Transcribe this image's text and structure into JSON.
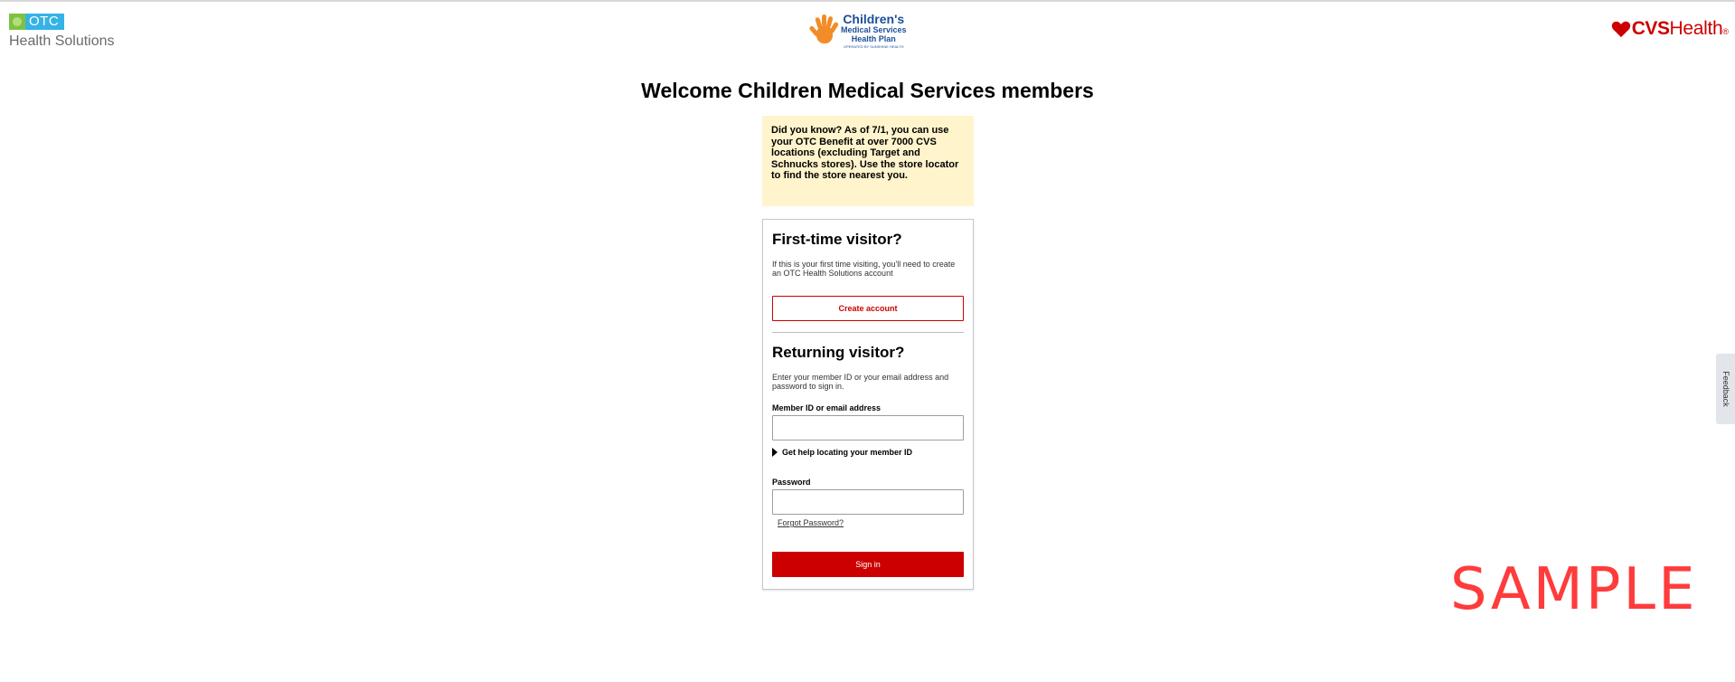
{
  "header": {
    "otc_logo": {
      "box_text": "OTC",
      "subtitle": "Health Solutions",
      "leaf_color": "#7fc241",
      "box_color": "#36b3e6"
    },
    "cms_logo": {
      "line1": "Children's",
      "line2": "Medical Services",
      "line3": "Health Plan",
      "line4": "OPERATED BY SUNSHINE HEALTH",
      "color": "#1c4f99",
      "hand_color": "#f28c28"
    },
    "cvs_logo": {
      "name": "CVS",
      "health": "Health",
      "reg": "®",
      "color": "#cc0000",
      "icon": "heart-icon"
    }
  },
  "page_title": "Welcome Children Medical Services members",
  "notice": {
    "text": "Did you know? As of 7/1, you can use your OTC Benefit at over 7000 CVS locations (excluding Target and Schnucks stores). Use the store locator to find the store nearest you.",
    "background": "#fff4cc"
  },
  "first_time": {
    "title": "First-time visitor?",
    "description": "If this is your first time visiting, you'll need to create an OTC Health Solutions account",
    "button_label": "Create account"
  },
  "returning": {
    "title": "Returning visitor?",
    "description": "Enter your member ID or your email address and password to sign in.",
    "member_label": "Member ID or email address",
    "member_value": "",
    "help_label": "Get help locating your member ID",
    "password_label": "Password",
    "password_value": "",
    "forgot_label": "Forgot Password?",
    "signin_label": "Sign in"
  },
  "feedback_label": "Feedback",
  "watermark": "SAMPLE",
  "colors": {
    "accent": "#cc0000"
  }
}
